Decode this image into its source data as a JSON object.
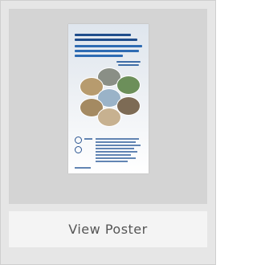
{
  "card": {
    "button_label": "View Poster"
  }
}
